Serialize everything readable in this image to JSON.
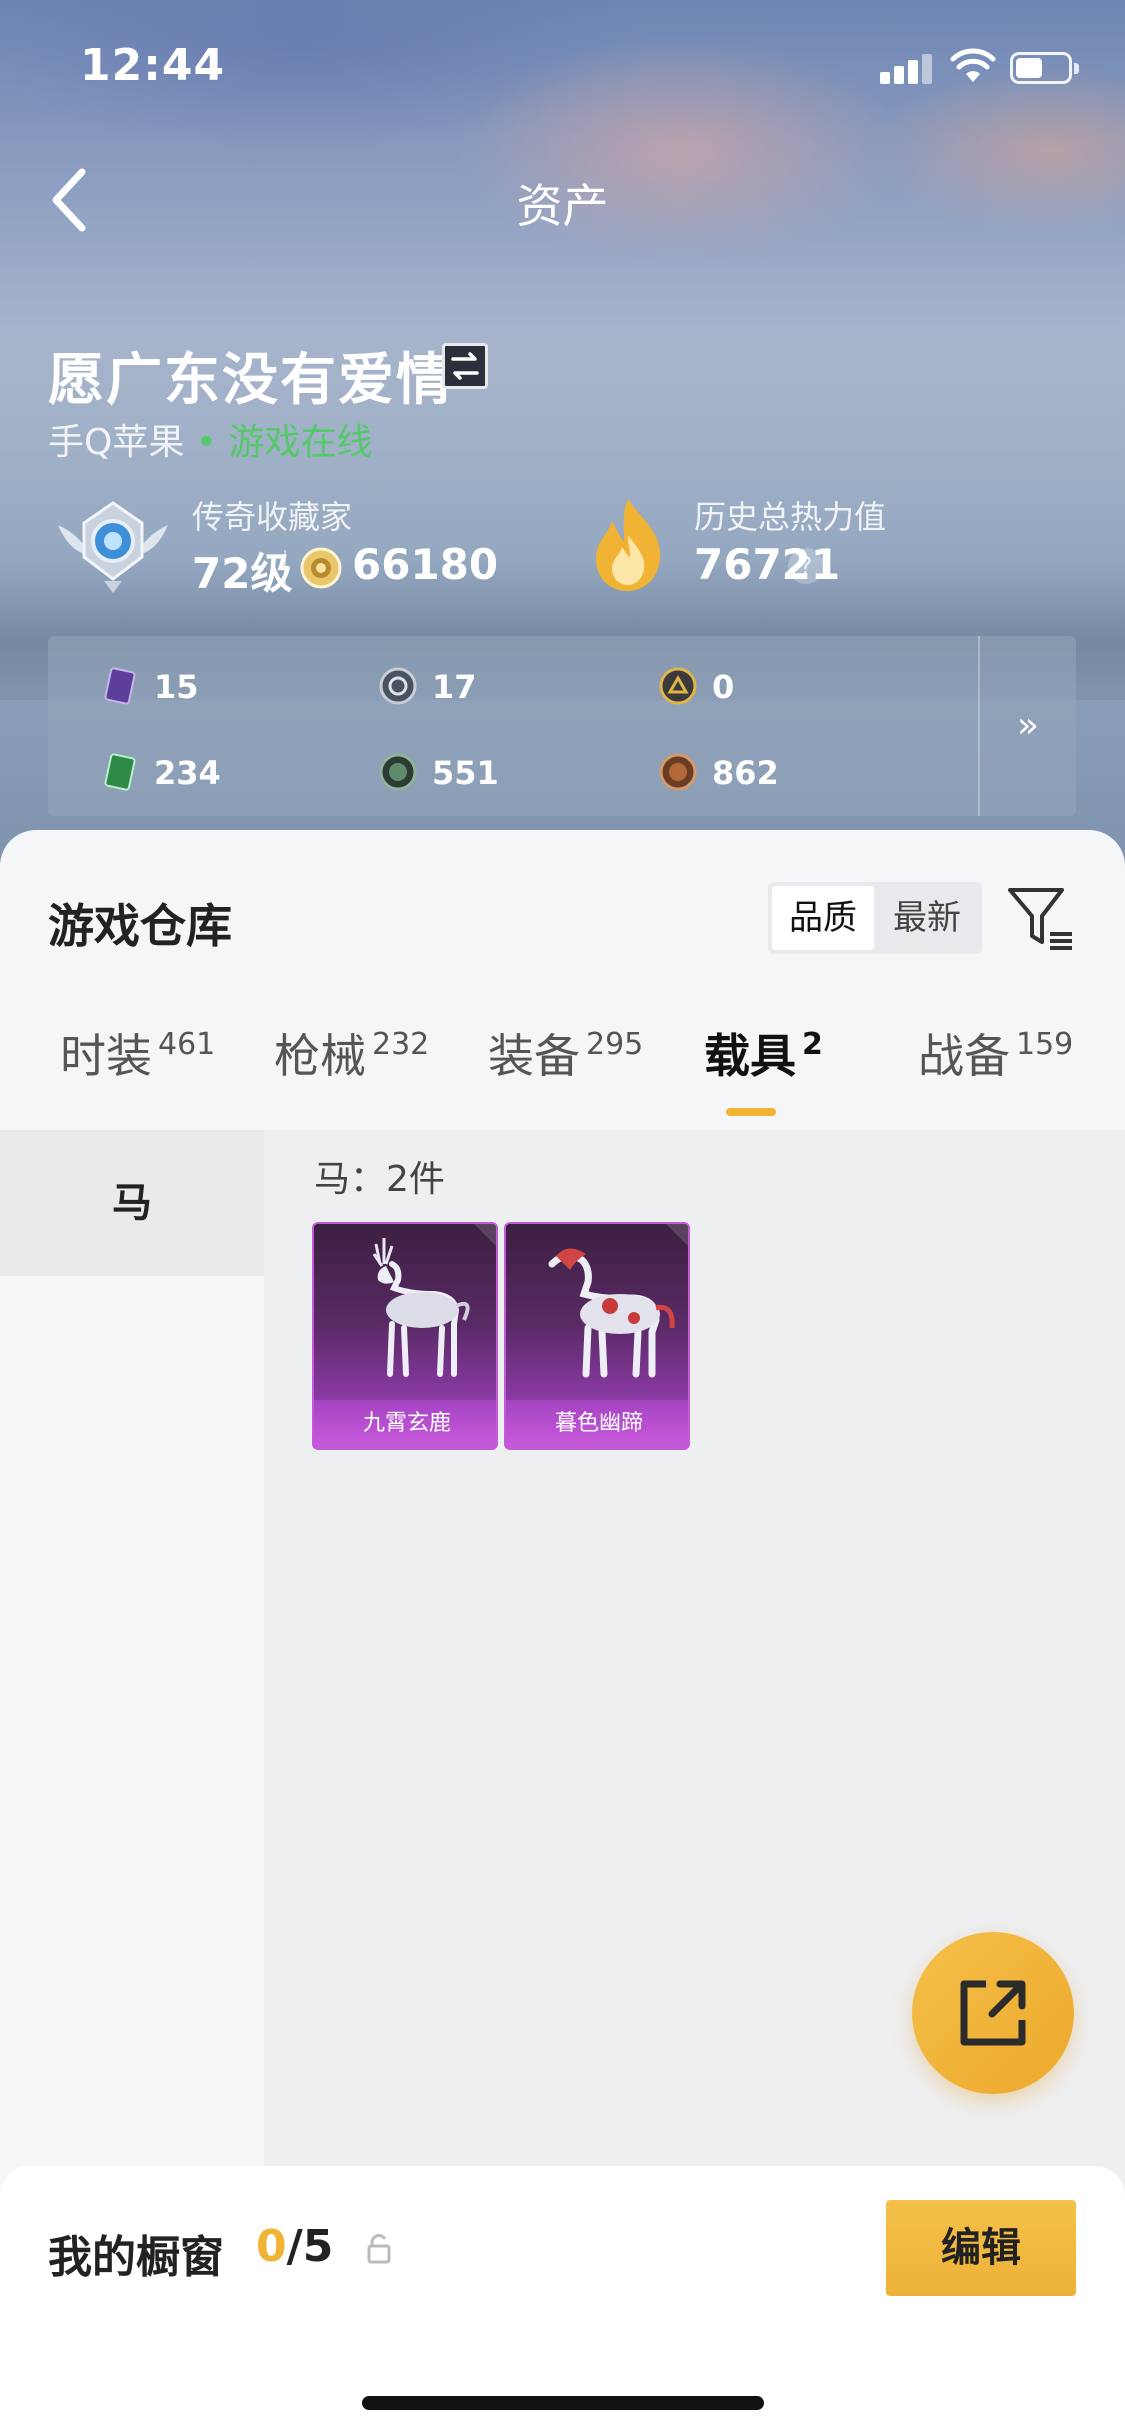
{
  "status_bar": {
    "time": "12:44"
  },
  "nav": {
    "title": "资产"
  },
  "profile": {
    "name": "愿广东没有爱情",
    "platform": "手Q苹果",
    "online_dot": "•",
    "online_status": "游戏在线",
    "collector_title": "传奇收藏家",
    "level": "72级",
    "coins": "66180",
    "heat_title": "历史总热力值",
    "heat_value": "76721",
    "help_glyph": "?"
  },
  "stats": [
    {
      "icon": "purple-card-icon",
      "value": "15"
    },
    {
      "icon": "silver-coin-icon",
      "value": "17"
    },
    {
      "icon": "gold-coin-icon",
      "value": "0"
    },
    {
      "icon": "green-card-icon",
      "value": "234"
    },
    {
      "icon": "green-coin-icon",
      "value": "551"
    },
    {
      "icon": "bronze-coin-icon",
      "value": "862"
    }
  ],
  "stats_more": "»",
  "warehouse": {
    "title": "游戏仓库",
    "sort_options": [
      "品质",
      "最新"
    ],
    "tabs": [
      {
        "label": "时装",
        "count": "461"
      },
      {
        "label": "枪械",
        "count": "232"
      },
      {
        "label": "装备",
        "count": "295"
      },
      {
        "label": "载具",
        "count": "2"
      },
      {
        "label": "战备",
        "count": "159"
      }
    ],
    "categories": [
      "马"
    ],
    "group_title": "马：2件",
    "items": [
      {
        "name": "九霄玄鹿"
      },
      {
        "name": "暮色幽蹄"
      }
    ]
  },
  "showcase": {
    "label": "我的橱窗",
    "current": "0",
    "total": "/5",
    "edit_label": "编辑"
  },
  "colors": {
    "accent": "#f0b333",
    "online": "#55c86a",
    "item_purple": "#8e3aa8"
  }
}
